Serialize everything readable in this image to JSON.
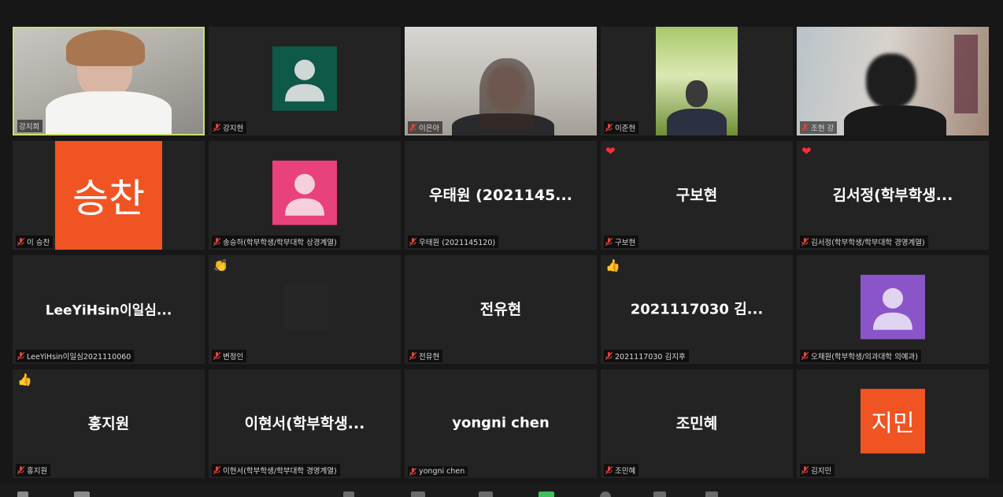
{
  "colors": {
    "active_border": "#c9e26a",
    "tile_bg": "#232323",
    "avatar_green": "#0e5948",
    "avatar_pink": "#e8417c",
    "avatar_purple": "#8a55c9",
    "letter_orange": "#f05422",
    "muted_icon": "#e0453a"
  },
  "tiles": [
    {
      "label": "강지희",
      "muted": false
    },
    {
      "label": "강지현",
      "muted": true
    },
    {
      "label": "이은아",
      "muted": true
    },
    {
      "label": "이준현",
      "muted": true
    },
    {
      "label": "조현 강",
      "muted": true
    },
    {
      "label": "이 승찬",
      "muted": true,
      "initials": "승찬"
    },
    {
      "label": "송승하(학부학생/학부대학 상경계열)",
      "muted": true
    },
    {
      "label": "우태원 (2021145120)",
      "muted": true,
      "display_name": "우태원 (2021145..."
    },
    {
      "label": "구보현",
      "muted": true,
      "display_name": "구보현",
      "reaction": "heart"
    },
    {
      "label": "김서정(학부학생/학부대학 경영계열)",
      "muted": true,
      "display_name": "김서정(학부학생...",
      "reaction": "heart"
    },
    {
      "label": "LeeYiHsin이일심2021110060",
      "muted": true,
      "display_name": "LeeYiHsin이일심..."
    },
    {
      "label": "변정인",
      "muted": true,
      "reaction": "clap"
    },
    {
      "label": "전유현",
      "muted": true,
      "display_name": "전유현"
    },
    {
      "label": "2021117030 김지후",
      "muted": true,
      "display_name": "2021117030 김...",
      "reaction": "thumbs-up"
    },
    {
      "label": "오채원(학부학생/의과대학 의예과)",
      "muted": true
    },
    {
      "label": "홍지원",
      "muted": true,
      "display_name": "홍지원",
      "reaction": "thumbs-up"
    },
    {
      "label": "이현서(학부학생/학부대학 경영계열)",
      "muted": true,
      "display_name": "이현서(학부학생..."
    },
    {
      "label": "yongni chen",
      "muted": true,
      "display_name": "yongni chen"
    },
    {
      "label": "조민혜",
      "muted": true,
      "display_name": "조민혜"
    },
    {
      "label": "김지민",
      "muted": true,
      "initials": "지민"
    }
  ],
  "reactions": {
    "heart": "❤",
    "clap": "👏",
    "thumbs-up": "👍"
  }
}
